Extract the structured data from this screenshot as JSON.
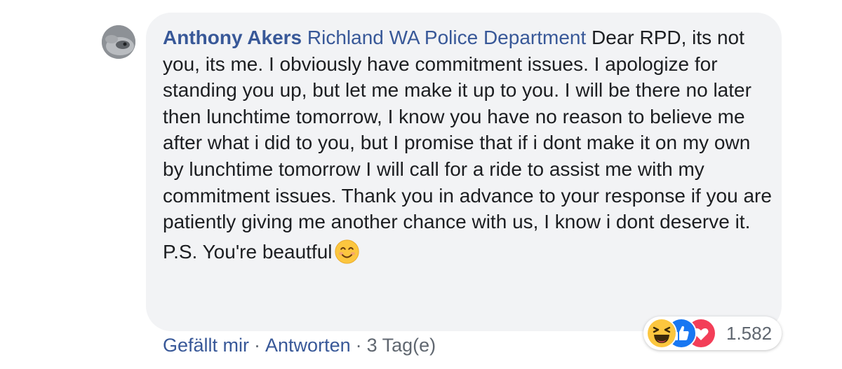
{
  "comment": {
    "author": "Anthony Akers",
    "tagged_page": "Richland WA Police Department",
    "body_after_tag": " Dear RPD, its not you, its me. I obviously have commitment issues. I apologize for standing you up, but let me make it up to you. I will be there no later then lunchtime tomorrow, I know you have no reason to believe me after what i did to you, but I promise that if i dont make it on my own by lunchtime tomorrow I will call for a ride to assist me with my commitment issues. Thank you in advance to your response if you are patiently giving me another chance with us, I know i dont deserve it.",
    "ps_text": "P.S. You're beautful",
    "ps_emoji": "smiling-face-emoji"
  },
  "reactions": {
    "icons": [
      "haha-icon",
      "like-icon",
      "love-icon"
    ],
    "count": "1.582"
  },
  "actions": {
    "like_label": "Gefällt mir",
    "reply_label": "Antworten",
    "separator": "·",
    "time": "3 Tag(e)"
  },
  "colors": {
    "link": "#385898",
    "bubble": "#f2f3f5",
    "like_blue": "#1877f2",
    "love_red": "#f33e58",
    "haha_yellow": "#fcc63f"
  }
}
